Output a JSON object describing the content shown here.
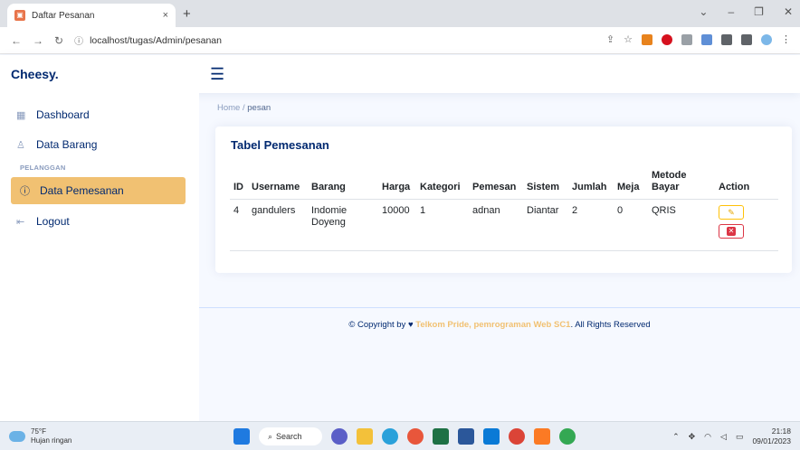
{
  "browser": {
    "tab_title": "Daftar Pesanan",
    "url": "localhost/tugas/Admin/pesanan",
    "new_tab": "+",
    "close_tab": "×"
  },
  "app": {
    "brand": "Cheesy."
  },
  "sidebar": {
    "items": [
      {
        "label": "Dashboard",
        "icon": "grid-icon"
      },
      {
        "label": "Data Barang",
        "icon": "user-icon"
      }
    ],
    "section_label": "PELANGGAN",
    "active_item": {
      "label": "Data Pemesanan",
      "icon": "question-circle-icon"
    },
    "logout": {
      "label": "Logout",
      "icon": "logout-icon"
    }
  },
  "breadcrumb": {
    "home": "Home",
    "separator": "/",
    "current": "pesan"
  },
  "card": {
    "title": "Tabel Pemesanan",
    "columns": [
      "ID",
      "Username",
      "Barang",
      "Harga",
      "Kategori",
      "Pemesan",
      "Sistem",
      "Jumlah",
      "Meja",
      "Metode Bayar",
      "Action"
    ],
    "rows": [
      {
        "id": "4",
        "username": "gandulers",
        "barang": "Indomie Doyeng",
        "harga": "10000",
        "kategori": "1",
        "pemesan": "adnan",
        "sistem": "Diantar",
        "jumlah": "2",
        "meja": "0",
        "metode": "QRIS"
      }
    ]
  },
  "footer": {
    "prefix": "© Copyright by",
    "highlight": "Telkom Pride, pemrograman Web SC1",
    "suffix": ". All Rights Reserved"
  },
  "taskbar": {
    "temperature": "75°F",
    "weather": "Hujan ringan",
    "search": "Search",
    "time": "21:18",
    "date": "09/01/2023"
  },
  "colors": {
    "accent": "#f1c172",
    "brand": "#012970",
    "danger": "#dc3545",
    "warning": "#ffc107"
  }
}
